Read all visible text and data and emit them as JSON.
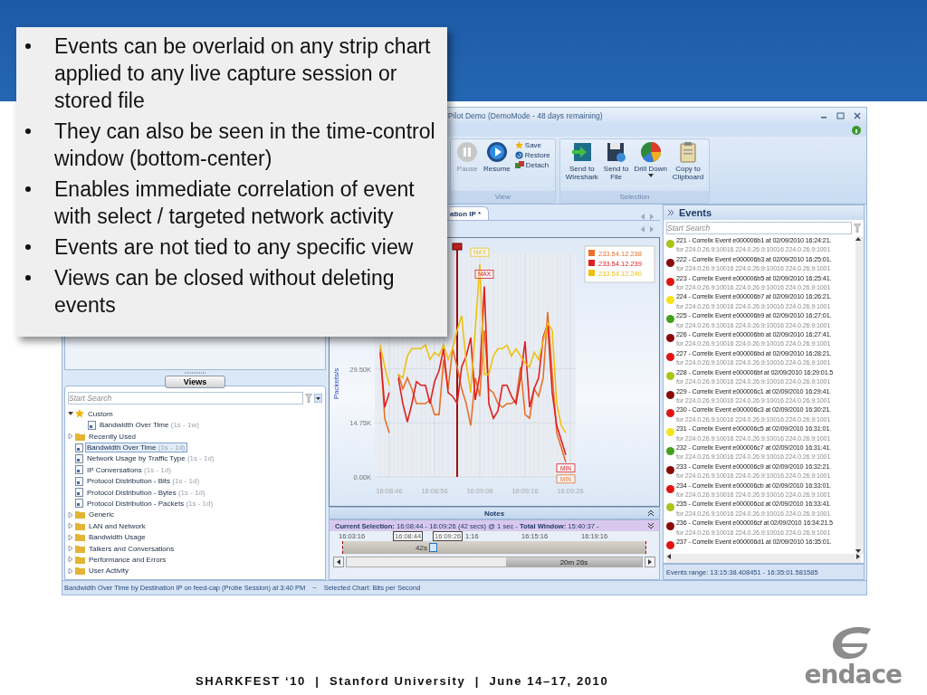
{
  "callout": {
    "bullets": [
      "Events can be overlaid on any strip chart applied to any live capture session or stored file",
      "They can also be seen in the time-control window (bottom-center)",
      "Enables immediate correlation of event with select / targeted network activity",
      "Events are not tied to any specific view",
      "Views can be closed without deleting events"
    ]
  },
  "window": {
    "title": "Pilot Demo (DemoMode - 48 days remaining)"
  },
  "ribbon": {
    "groups": [
      {
        "label": "View",
        "items": [
          {
            "kind": "large",
            "label": "Pause",
            "disabled": true
          },
          {
            "kind": "large",
            "label": "Resume",
            "disabled": false
          },
          {
            "kind": "small",
            "label": "Save",
            "disabled": false
          },
          {
            "kind": "small",
            "label": "Restore",
            "disabled": false
          },
          {
            "kind": "small",
            "label": "Detach",
            "disabled": false
          }
        ]
      },
      {
        "label": "Selection",
        "items": [
          {
            "kind": "large",
            "label": "Send to\nWireshark",
            "disabled": false
          },
          {
            "kind": "large",
            "label": "Send to\nFile",
            "disabled": false
          },
          {
            "kind": "large",
            "label": "Drill Down",
            "disabled": false,
            "dropdown": true
          },
          {
            "kind": "large",
            "label": "Copy to\nClipboard",
            "disabled": false
          }
        ]
      }
    ]
  },
  "views": {
    "button": "Views",
    "search": {
      "placeholder": "Start Search"
    },
    "tree": [
      {
        "kind": "favorite",
        "label": "Custom",
        "expanded": true,
        "selected": false,
        "children": [
          {
            "kind": "view",
            "label": "Bandwidth Over Time",
            "range": "(1s - 1w)",
            "selected": false
          }
        ]
      },
      {
        "kind": "folder",
        "label": "Recently Used",
        "expanded": false,
        "selected": false
      },
      {
        "kind": "view",
        "label": "Bandwidth Over Time",
        "range": "(1s - 1d)",
        "selected": true
      },
      {
        "kind": "view",
        "label": "Network Usage by Traffic Type",
        "range": "(1s - 1d)",
        "selected": false
      },
      {
        "kind": "view",
        "label": "IP Conversations",
        "range": "(1s - 1d)",
        "selected": false
      },
      {
        "kind": "view",
        "label": "Protocol Distribution - Bits",
        "range": "(1s - 1d)",
        "selected": false
      },
      {
        "kind": "view",
        "label": "Protocol Distribution - Bytes",
        "range": "(1s - 1d)",
        "selected": false
      },
      {
        "kind": "view",
        "label": "Protocol Distribution - Packets",
        "range": "(1s - 1d)",
        "selected": false
      },
      {
        "kind": "folder",
        "label": "Generic",
        "expanded": false,
        "selected": false
      },
      {
        "kind": "folder",
        "label": "LAN and Network",
        "expanded": false,
        "selected": false
      },
      {
        "kind": "folder",
        "label": "Bandwidth Usage",
        "expanded": false,
        "selected": false
      },
      {
        "kind": "folder",
        "label": "Talkers and Conversations",
        "expanded": false,
        "selected": false
      },
      {
        "kind": "folder",
        "label": "Performance and Errors",
        "expanded": false,
        "selected": false
      },
      {
        "kind": "folder",
        "label": "User Activity",
        "expanded": false,
        "selected": false
      }
    ]
  },
  "chart_tab": {
    "label": "ation IP *"
  },
  "chart": {
    "chart_data": {
      "type": "line",
      "ylabel": "Packets/s",
      "categories": [
        null,
        null,
        "16:08:46",
        null,
        null,
        null,
        null,
        null,
        null,
        null,
        null,
        null,
        "16:08:56",
        null,
        null,
        null,
        null,
        null,
        null,
        null,
        null,
        null,
        "16:09:06",
        null,
        null,
        null,
        null,
        null,
        null,
        null,
        null,
        null,
        "16:09:16",
        null,
        null,
        null,
        null,
        null,
        null,
        null,
        null,
        null,
        "16:09:26"
      ],
      "ylim": [
        0,
        61
      ],
      "grid": true,
      "legend": "upper right",
      "series": [
        {
          "name": "233.54.12.238",
          "color": "#e8702a",
          "values": [
            35,
            16,
            12,
            null,
            28,
            24,
            27,
            24,
            20,
            20,
            20,
            21,
            17,
            17,
            32,
            24,
            35,
            30,
            24,
            20,
            14,
            27,
            22,
            40,
            24,
            23,
            20,
            19,
            20,
            20,
            21,
            30,
            17,
            16,
            24,
            22,
            27,
            45,
            28,
            12,
            8,
            4,
            null
          ]
        },
        {
          "name": "233.54.12.239",
          "color": "#e02020",
          "values": [
            34,
            19,
            23,
            null,
            27,
            20,
            15,
            20,
            26,
            25,
            25,
            20,
            26,
            29,
            35,
            23,
            22,
            20,
            30,
            33,
            38,
            21,
            28,
            52,
            20,
            16,
            18,
            25,
            25,
            22,
            20,
            27,
            37,
            19,
            24,
            27,
            38,
            42,
            23,
            14,
            10,
            6,
            null
          ]
        },
        {
          "name": "233.54.12.240",
          "color": "#f0c010",
          "values": [
            36,
            30,
            25,
            null,
            28,
            27,
            33,
            35,
            35,
            35,
            36,
            32,
            34,
            33,
            36,
            32,
            35,
            40,
            44,
            31,
            23,
            40,
            58,
            28,
            28,
            33,
            35,
            35,
            36,
            33,
            35,
            33,
            31,
            30,
            34,
            32,
            37,
            42,
            40,
            20,
            14,
            12,
            null
          ]
        }
      ],
      "yticks": [
        {
          "value": 0,
          "label": "0.00K"
        },
        {
          "value": 14.75,
          "label": "14.75K"
        },
        {
          "value": 29.5,
          "label": "29.50K"
        }
      ],
      "annotations": [
        {
          "text": "MAX",
          "y": 58
        },
        {
          "text": "MAX",
          "y": 52
        },
        {
          "text": "MIN",
          "y": 6
        },
        {
          "text": "MIN",
          "y": 4
        }
      ]
    }
  },
  "notes": {
    "label": "Notes"
  },
  "time_control": {
    "summary": "**Current  Selection:** 16:08:44 - 16:09:26 (42 secs) @ 1 sec  -  **Total  Window:** 15:40:37 -",
    "ticks": [
      {
        "label": "16:03:16",
        "kind": "tick"
      },
      {
        "label": "16:08:44",
        "kind": "handle"
      },
      {
        "label": "16:09:26",
        "kind": "handle"
      },
      {
        "label": "1:16",
        "kind": "tick"
      },
      {
        "label": "16:15:16",
        "kind": "tick"
      },
      {
        "label": "16:19:16",
        "kind": "tick"
      }
    ],
    "selection": "42s",
    "window_length": "20m 26s"
  },
  "events": {
    "title": "Events",
    "search": {
      "placeholder": "Start Search"
    },
    "items": [
      {
        "title": "221 - Correlix Event e000006b1 at 02/09/2010 16:24:21.",
        "detail": "for  224.0.26.9:10016  224.0.26.9:10016  224.0.26.9:1001",
        "color": "#a8c418"
      },
      {
        "title": "222 - Correlix Event e000006b3 at 02/09/2010 16:25:01.",
        "detail": "for  224.0.26.9:10016  224.0.26.9:10016  224.0.26.9:1001",
        "color": "#8a0a0a"
      },
      {
        "title": "223 - Correlix Event e000006b5 at 02/09/2010 16:25:41.",
        "detail": "for  224.0.26.9:10016  224.0.26.9:10016  224.0.26.9:1001",
        "color": "#e01414"
      },
      {
        "title": "224 - Correlix Event e000006b7 at 02/09/2010 16:26:21.",
        "detail": "for  224.0.26.9:10016  224.0.26.9:10016  224.0.26.9:1001",
        "color": "#f5e41c"
      },
      {
        "title": "225 - Correlix Event e000006b9 at 02/09/2010 16:27:01.",
        "detail": "for  224.0.26.9:10016  224.0.26.9:10016  224.0.26.9:1001",
        "color": "#44a01c"
      },
      {
        "title": "226 - Correlix Event e000006bb at 02/09/2010 16:27:41.",
        "detail": "for  224.0.26.9:10016  224.0.26.9:10016  224.0.26.9:1001",
        "color": "#8a0a0a"
      },
      {
        "title": "227 - Correlix Event e000006bd at 02/09/2010 16:28:21.",
        "detail": "for  224.0.26.9:10016  224.0.26.9:10016  224.0.26.9:1001",
        "color": "#e01414"
      },
      {
        "title": "228 - Correlix Event e000006bf at 02/09/2010 16:29:01.5",
        "detail": "for  224.0.26.9:10016  224.0.26.9:10016  224.0.26.9:1001",
        "color": "#a8c418"
      },
      {
        "title": "229 - Correlix Event e000006c1 at 02/09/2010 16:29:41.",
        "detail": "for  224.0.26.9:10016  224.0.26.9:10016  224.0.26.9:1001",
        "color": "#8a0a0a"
      },
      {
        "title": "230 - Correlix Event e000006c3 at 02/09/2010 16:30:21.",
        "detail": "for  224.0.26.9:10016  224.0.26.9:10016  224.0.26.9:1001",
        "color": "#e01414"
      },
      {
        "title": "231 - Correlix Event e000006c5 at 02/09/2010 16:31:01.",
        "detail": "for  224.0.26.9:10016  224.0.26.9:10016  224.0.26.9:1001",
        "color": "#f5e41c"
      },
      {
        "title": "232 - Correlix Event e000006c7 at 02/09/2010 16:31:41.",
        "detail": "for  224.0.26.9:10016  224.0.26.9:10016  224.0.26.9:1001",
        "color": "#44a01c"
      },
      {
        "title": "233 - Correlix Event e000006c9 at 02/09/2010 16:32:21.",
        "detail": "for  224.0.26.9:10016  224.0.26.9:10016  224.0.26.9:1001",
        "color": "#8a0a0a"
      },
      {
        "title": "234 - Correlix Event e000006cb at 02/09/2010 16:33:01.",
        "detail": "for  224.0.26.9:10016  224.0.26.9:10016  224.0.26.9:1001",
        "color": "#e01414"
      },
      {
        "title": "235 - Correlix Event e000006cd at 02/09/2010 16:33:41.",
        "detail": "for  224.0.26.9:10016  224.0.26.9:10016  224.0.26.9:1001",
        "color": "#a8c418"
      },
      {
        "title": "236 - Correlix Event e000006cf at 02/09/2010 16:34:21.5",
        "detail": "for  224.0.26.9:10016  224.0.26.9:10016  224.0.26.9:1001",
        "color": "#8a0a0a"
      },
      {
        "title": "237 - Correlix Event e000006d1 at 02/09/2010 16:35:01.",
        "color": "#e01414"
      }
    ],
    "range": "Events range: 13:15:38.408451 - 16:35:01.581585"
  },
  "status_bar": {
    "left": "Bandwidth Over Time by Destination IP on feed-cap (Probe Session) at 3:40 PM",
    "separator": "~",
    "right": "Selected Chart: Bits per Second"
  },
  "footer": "SHARKFEST ‘10  |  Stanford University  |  June 14–17, 2010",
  "logo": {
    "text": "endace"
  }
}
